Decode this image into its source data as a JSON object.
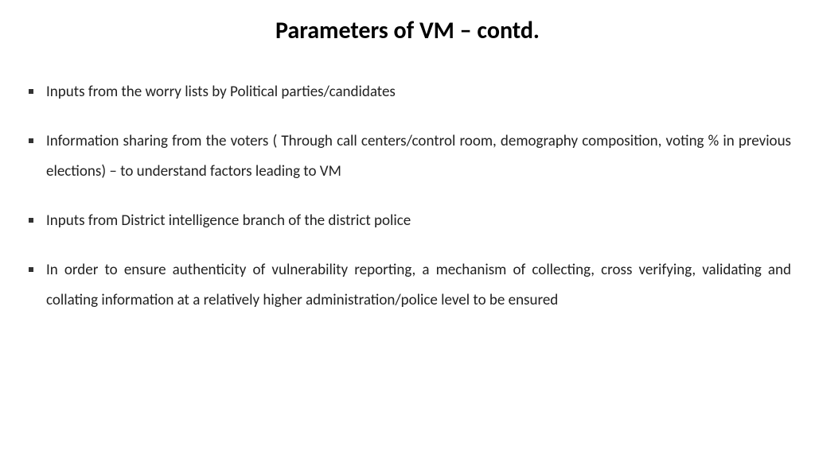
{
  "title": "Parameters of VM – contd.",
  "bullets": [
    {
      "text": "Inputs from the worry lists by Political parties/candidates",
      "justified": false
    },
    {
      "text": "Information sharing from the voters ( Through call centers/control room, demography composition, voting % in previous elections) – to understand factors leading to VM",
      "justified": true
    },
    {
      "text": "Inputs from District intelligence branch of the district police",
      "justified": false
    },
    {
      "text": "In order  to ensure authenticity of vulnerability reporting, a mechanism of collecting, cross verifying, validating and collating information at a relatively higher administration/police level to be ensured",
      "justified": true
    }
  ]
}
